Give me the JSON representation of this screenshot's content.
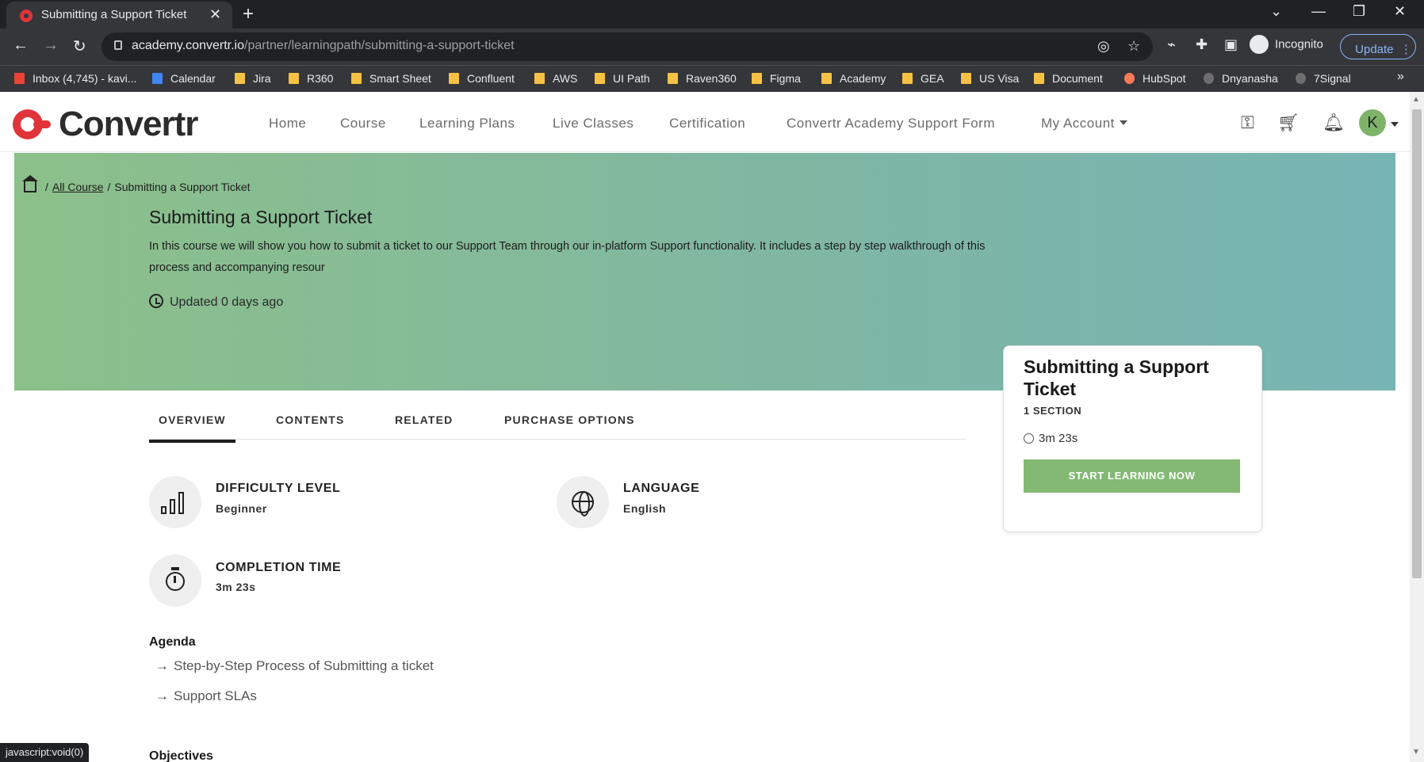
{
  "browser": {
    "tab_title": "Submitting a Support Ticket",
    "url_host": "academy.convertr.io",
    "url_path": "/partner/learningpath/submitting-a-support-ticket",
    "incognito_label": "Incognito",
    "update_label": "Update",
    "status_link": "javascript:void(0)",
    "bookmarks": [
      "Inbox (4,745) - kavi...",
      "Calendar",
      "Jira",
      "R360",
      "Smart Sheet",
      "Confluent",
      "AWS",
      "UI Path",
      "Raven360",
      "Figma",
      "Academy",
      "GEA",
      "US Visa",
      "Document",
      "HubSpot",
      "Dnyanasha",
      "7Signal"
    ]
  },
  "site": {
    "logo_text": "Convertr",
    "menu": [
      "Home",
      "Course",
      "Learning Plans",
      "Live Classes",
      "Certification",
      "Convertr Academy Support Form"
    ],
    "account_label": "My Account",
    "avatar_initial": "K"
  },
  "hero": {
    "breadcrumb_link": "All Course",
    "breadcrumb_current": "Submitting a Support Ticket",
    "title": "Submitting a Support Ticket",
    "description": "In this course we will show you how to submit a ticket to our Support Team through our in-platform Support functionality. It includes a step by step walkthrough of this process and accompanying resour",
    "updated": "Updated 0 days ago"
  },
  "card": {
    "title": "Submitting a Support Ticket",
    "sections": "1 SECTION",
    "duration": "3m 23s",
    "cta": "START LEARNING NOW"
  },
  "tabs": [
    "OVERVIEW",
    "CONTENTS",
    "RELATED",
    "PURCHASE OPTIONS"
  ],
  "overview": {
    "difficulty_label": "DIFFICULTY LEVEL",
    "difficulty_value": "Beginner",
    "language_label": "LANGUAGE",
    "language_value": "English",
    "completion_label": "COMPLETION TIME",
    "completion_value": "3m 23s",
    "agenda_heading": "Agenda",
    "agenda": [
      "Step-by-Step Process of Submitting a ticket",
      "Support SLAs"
    ],
    "objectives_heading": "Objectives"
  },
  "colors": {
    "brand_red": "#e0343b",
    "cta_green": "#83b973",
    "hero_start": "#8cc08a",
    "hero_end": "#77b5b5"
  }
}
